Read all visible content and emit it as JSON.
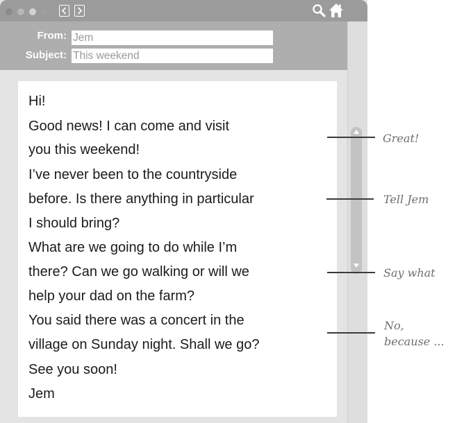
{
  "email": {
    "from_label": "From:",
    "from_value": "Jem",
    "subject_label": "Subject:",
    "subject_value": "This weekend",
    "body_lines": [
      "Hi!",
      "Good news! I can come and visit",
      "you this weekend!",
      "I’ve never been to the countryside",
      "before. Is there anything in particular",
      "I should bring?",
      "What are we going to do while I’m",
      "there? Can we go walking or will we",
      "help your dad on the farm?",
      "You said there was a concert in the",
      "village on Sunday night. Shall we go?",
      "See you soon!",
      "Jem"
    ]
  },
  "annotations": {
    "note1": "Great!",
    "note2": "Tell Jem",
    "note3": "Say what",
    "note4_line1": "No,",
    "note4_line2": "because ..."
  },
  "icons": {
    "search": "search-icon",
    "home": "home-icon",
    "back": "chevron-left-icon",
    "forward": "chevron-right-icon"
  },
  "colors": {
    "titlebar": "#9b9b9b",
    "header": "#aeaeae",
    "window_bg": "#e4e4e4",
    "text": "#1b1b1b"
  }
}
